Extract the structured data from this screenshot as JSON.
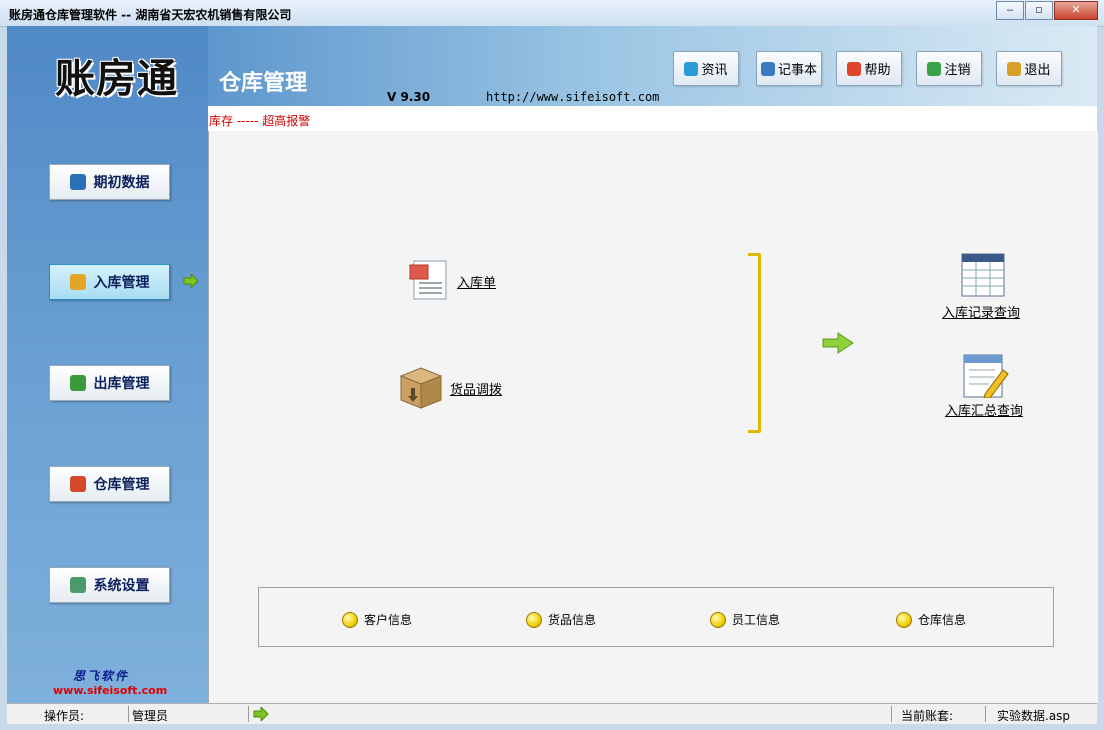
{
  "window": {
    "title": "账房通仓库管理软件 -- 湖南省天宏农机销售有限公司",
    "minimize": "‒",
    "restore": "▫",
    "close": "✕"
  },
  "header": {
    "logo": "账房通",
    "subtitle": "仓库管理",
    "version": "V 9.30",
    "url": "http://www.sifeisoft.com",
    "buttons": [
      {
        "label": "资讯",
        "icon": "news-icon",
        "color": "#2a9bd6"
      },
      {
        "label": "记事本",
        "icon": "notepad-icon",
        "color": "#3a7ac0"
      },
      {
        "label": "帮助",
        "icon": "help-icon",
        "color": "#e0442a"
      },
      {
        "label": "注销",
        "icon": "logout-icon",
        "color": "#3aa04a"
      },
      {
        "label": "退出",
        "icon": "exit-icon",
        "color": "#d6a02a"
      }
    ]
  },
  "marquee": "库存 ----- 超高报警",
  "sidebar": {
    "items": [
      {
        "label": "期初数据",
        "icon": "book-icon",
        "color": "#2a6fb8",
        "active": false
      },
      {
        "label": "入库管理",
        "icon": "box-in-icon",
        "color": "#e2a524",
        "active": true
      },
      {
        "label": "出库管理",
        "icon": "user-out-icon",
        "color": "#3a9a3a",
        "active": false
      },
      {
        "label": "仓库管理",
        "icon": "house-icon",
        "color": "#d24a2a",
        "active": false
      },
      {
        "label": "系统设置",
        "icon": "gears-icon",
        "color": "#4a9a6a",
        "active": false
      }
    ],
    "brand_cn": "思飞软件",
    "brand_url": "www.sifeisoft.com"
  },
  "main": {
    "actions": {
      "receipt": "入库单",
      "transfer": "货品调拨",
      "record_query": "入库记录查询",
      "summary_query": "入库汇总查询"
    },
    "info_links": [
      "客户信息",
      "货品信息",
      "员工信息",
      "仓库信息"
    ]
  },
  "status": {
    "operator_label": "操作员:",
    "operator_value": "管理员",
    "account_label": "当前账套:",
    "account_value": "实验数据.asp"
  }
}
